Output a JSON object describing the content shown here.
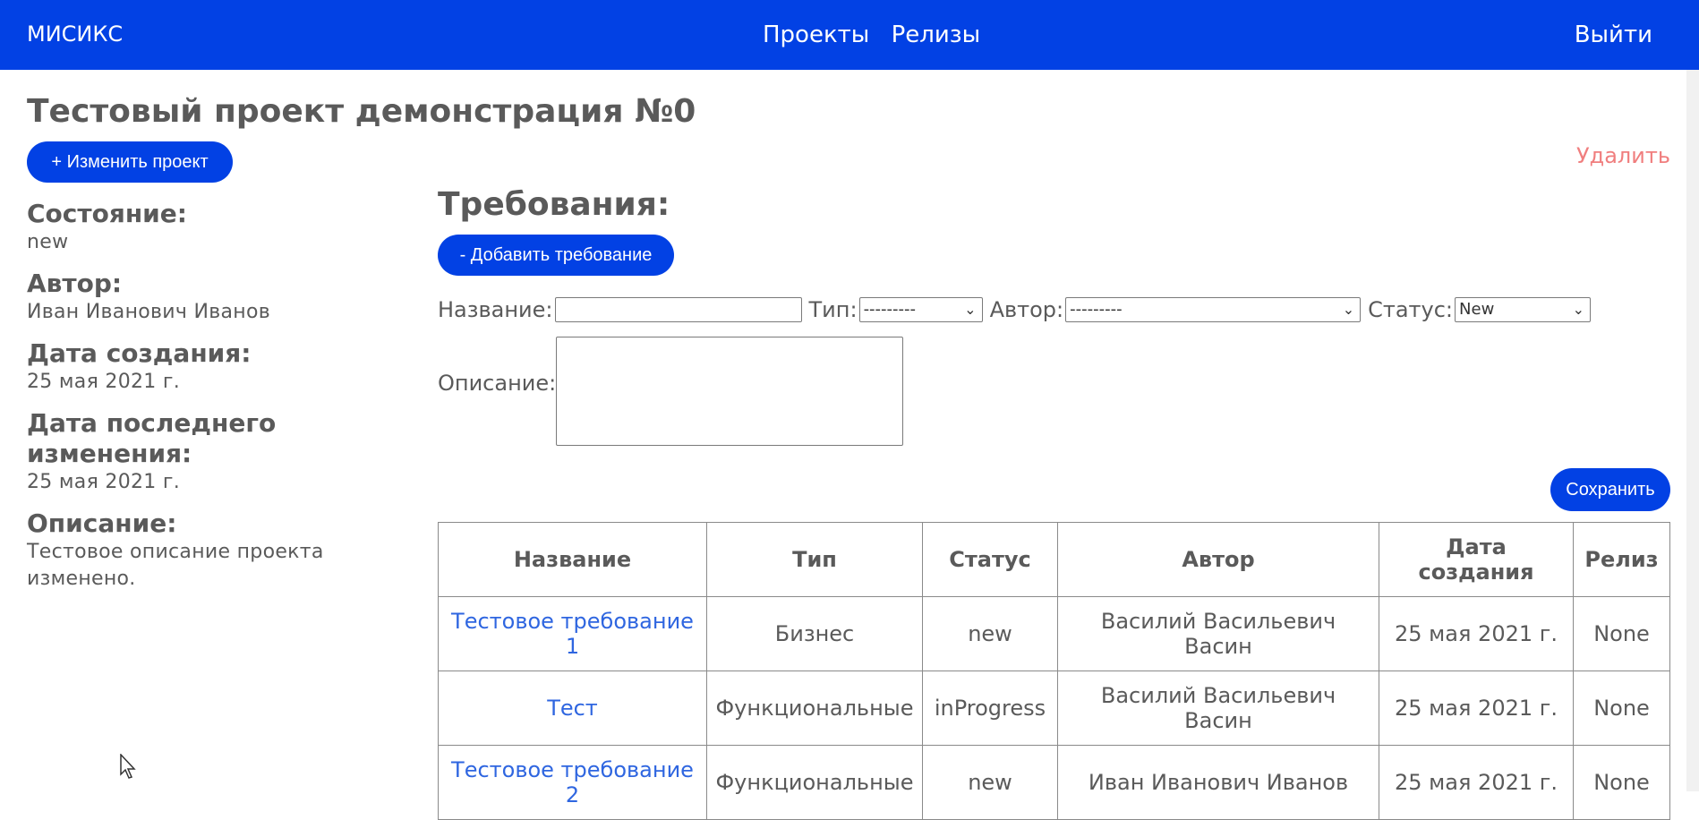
{
  "header": {
    "brand": "МИСИКС",
    "nav": [
      "Проекты",
      "Релизы"
    ],
    "logout": "Выйти",
    "bg_color": "#0241e4"
  },
  "project": {
    "title": "Тестовый проект демонстрация №0",
    "edit_button": "+ Изменить проект",
    "delete_link": "Удалить",
    "fields": [
      {
        "label": "Состояние:",
        "value": "new"
      },
      {
        "label": "Автор:",
        "value": "Иван Иванович Иванов"
      },
      {
        "label": "Дата создания:",
        "value": "25 мая 2021 г."
      },
      {
        "label": "Дата последнего изменения:",
        "value": "25 мая 2021 г."
      },
      {
        "label": "Описание:",
        "value": "Тестовое описание проекта изменено."
      }
    ]
  },
  "requirements": {
    "title": "Требования:",
    "add_button": "- Добавить требование",
    "form": {
      "name_label": "Название:",
      "name_value": "",
      "type_label": "Тип:",
      "type_value": "---------",
      "author_label": "Автор:",
      "author_value": "---------",
      "status_label": "Статус:",
      "status_value": "New",
      "description_label": "Описание:",
      "description_value": "",
      "save_button": "Сохранить"
    },
    "table": {
      "columns": [
        "Название",
        "Тип",
        "Статус",
        "Автор",
        "Дата создания",
        "Релиз"
      ],
      "rows": [
        [
          "Тестовое требование 1",
          "Бизнес",
          "new",
          "Василий Васильевич Васин",
          "25 мая 2021 г.",
          "None"
        ],
        [
          "Тест",
          "Функциональные",
          "inProgress",
          "Василий Васильевич Васин",
          "25 мая 2021 г.",
          "None"
        ],
        [
          "Тестовое требование 2",
          "Функциональные",
          "new",
          "Иван Иванович Иванов",
          "25 мая 2021 г.",
          "None"
        ]
      ]
    }
  }
}
